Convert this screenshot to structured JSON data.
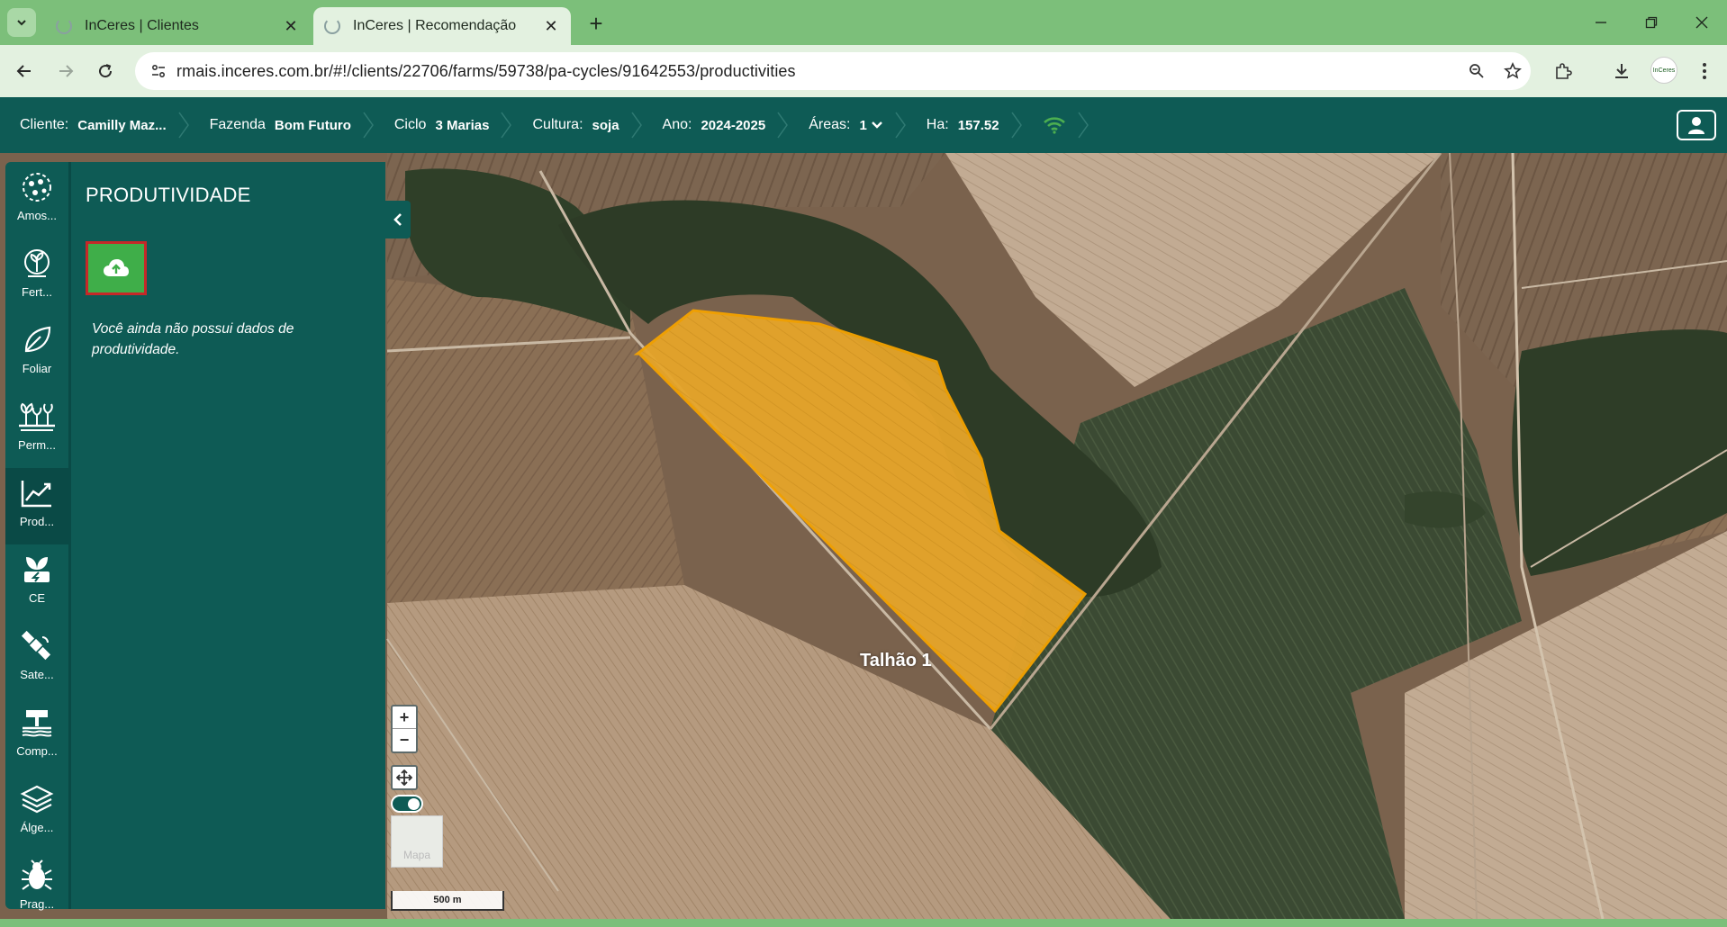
{
  "browser": {
    "tabs": [
      {
        "title": "InCeres | Clientes",
        "active": false
      },
      {
        "title": "InCeres | Recomendação",
        "active": true
      }
    ],
    "url": "rmais.inceres.com.br/#!/clients/22706/farms/59738/pa-cycles/91642553/productivities",
    "profile_label": "InCeres"
  },
  "header": {
    "crumbs": [
      {
        "label": "Cliente:",
        "value": "Camilly Maz..."
      },
      {
        "label": "Fazenda",
        "value": "Bom Futuro"
      },
      {
        "label": "Ciclo",
        "value": "3 Marias"
      },
      {
        "label": "Cultura:",
        "value": "soja"
      },
      {
        "label": "Ano:",
        "value": "2024-2025"
      },
      {
        "label": "Áreas:",
        "value": "1"
      },
      {
        "label": "Ha:",
        "value": "157.52"
      }
    ],
    "wifi_icon": "wifi-icon",
    "wifi_color": "#4caf50"
  },
  "sidebar": {
    "items": [
      {
        "label": "Amos...",
        "icon": "sampling-icon",
        "active": false
      },
      {
        "label": "Fert...",
        "icon": "fertilization-icon",
        "active": false
      },
      {
        "label": "Foliar",
        "icon": "leaf-icon",
        "active": false
      },
      {
        "label": "Perm...",
        "icon": "plants-icon",
        "active": false
      },
      {
        "label": "Prod...",
        "icon": "chart-line-icon",
        "active": true
      },
      {
        "label": "CE",
        "icon": "plant-energy-icon",
        "active": false
      },
      {
        "label": "Sate...",
        "icon": "satellite-icon",
        "active": false
      },
      {
        "label": "Comp...",
        "icon": "compaction-icon",
        "active": false
      },
      {
        "label": "Álge...",
        "icon": "layers-icon",
        "active": false
      },
      {
        "label": "Prag...",
        "icon": "bug-icon",
        "active": false
      }
    ]
  },
  "panel": {
    "title": "PRODUTIVIDADE",
    "upload_icon": "cloud-upload-icon",
    "empty_message": "Você ainda não possui dados de produtividade."
  },
  "map": {
    "field_label": "Talhão 1",
    "field_color": "#e6a52a",
    "maptype_label": "Mapa",
    "scale_label": "500 m",
    "zoom_in": "+",
    "zoom_out": "−"
  },
  "colors": {
    "brand": "#0e5b55",
    "upload_button": "#3fae49",
    "highlight_border": "#c62828",
    "chrome": "#7cbf7a"
  }
}
